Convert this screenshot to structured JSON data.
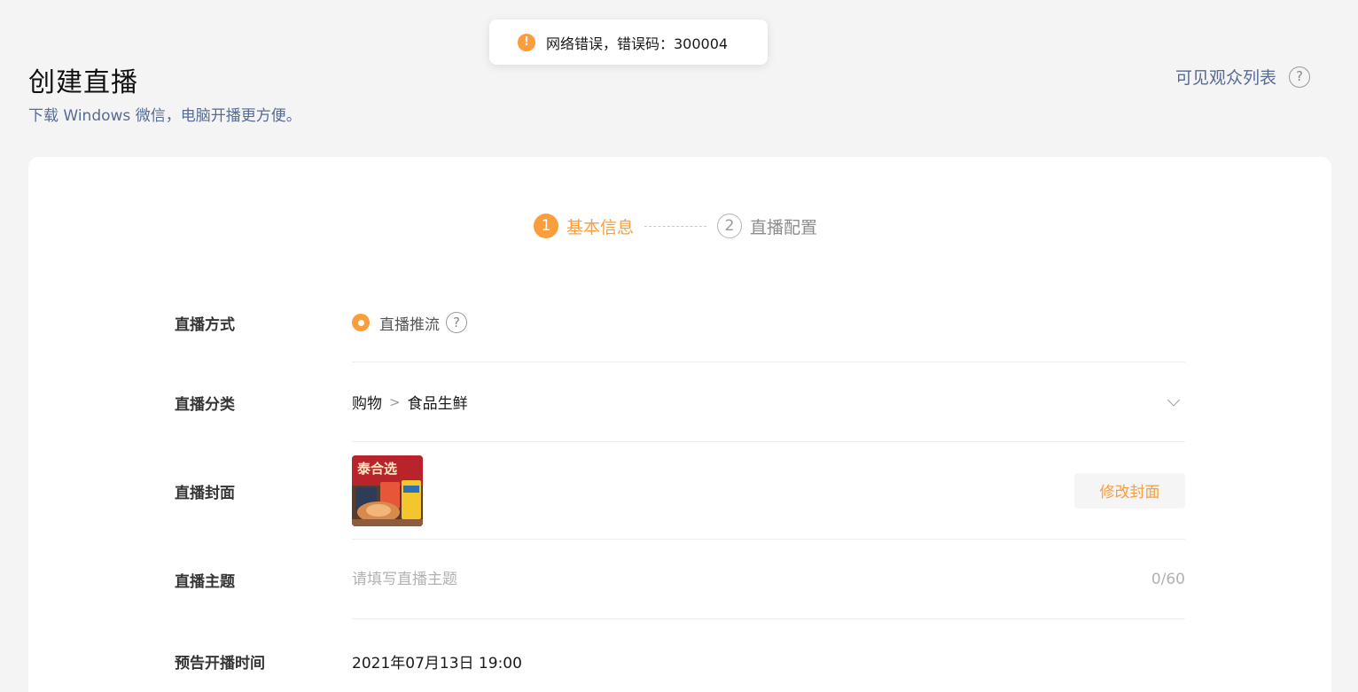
{
  "toast": {
    "icon": "warning-icon",
    "text": "网络错误，错误码：300004"
  },
  "header": {
    "title": "创建直播",
    "subtitle": "下载 Windows 微信，电脑开播更方便。",
    "audience_link": "可见观众列表",
    "help_glyph": "?"
  },
  "steps": [
    {
      "num": "1",
      "label": "基本信息",
      "state": "active"
    },
    {
      "num": "2",
      "label": "直播配置",
      "state": "inactive"
    }
  ],
  "form": {
    "method": {
      "label": "直播方式",
      "option": "直播推流",
      "help_glyph": "?",
      "selected": true
    },
    "category": {
      "label": "直播分类",
      "level1": "购物",
      "level2": "食品生鲜"
    },
    "cover": {
      "label": "直播封面",
      "thumb_text": "泰合选",
      "modify_label": "修改封面"
    },
    "topic": {
      "label": "直播主题",
      "placeholder": "请填写直播主题",
      "value": "",
      "count": "0/60"
    },
    "schedule": {
      "label": "预告开播时间",
      "value": "2021年07月13日 19:00"
    }
  },
  "colors": {
    "accent": "#fa9d3b",
    "link": "#576b95",
    "background": "#f4f4f4"
  }
}
